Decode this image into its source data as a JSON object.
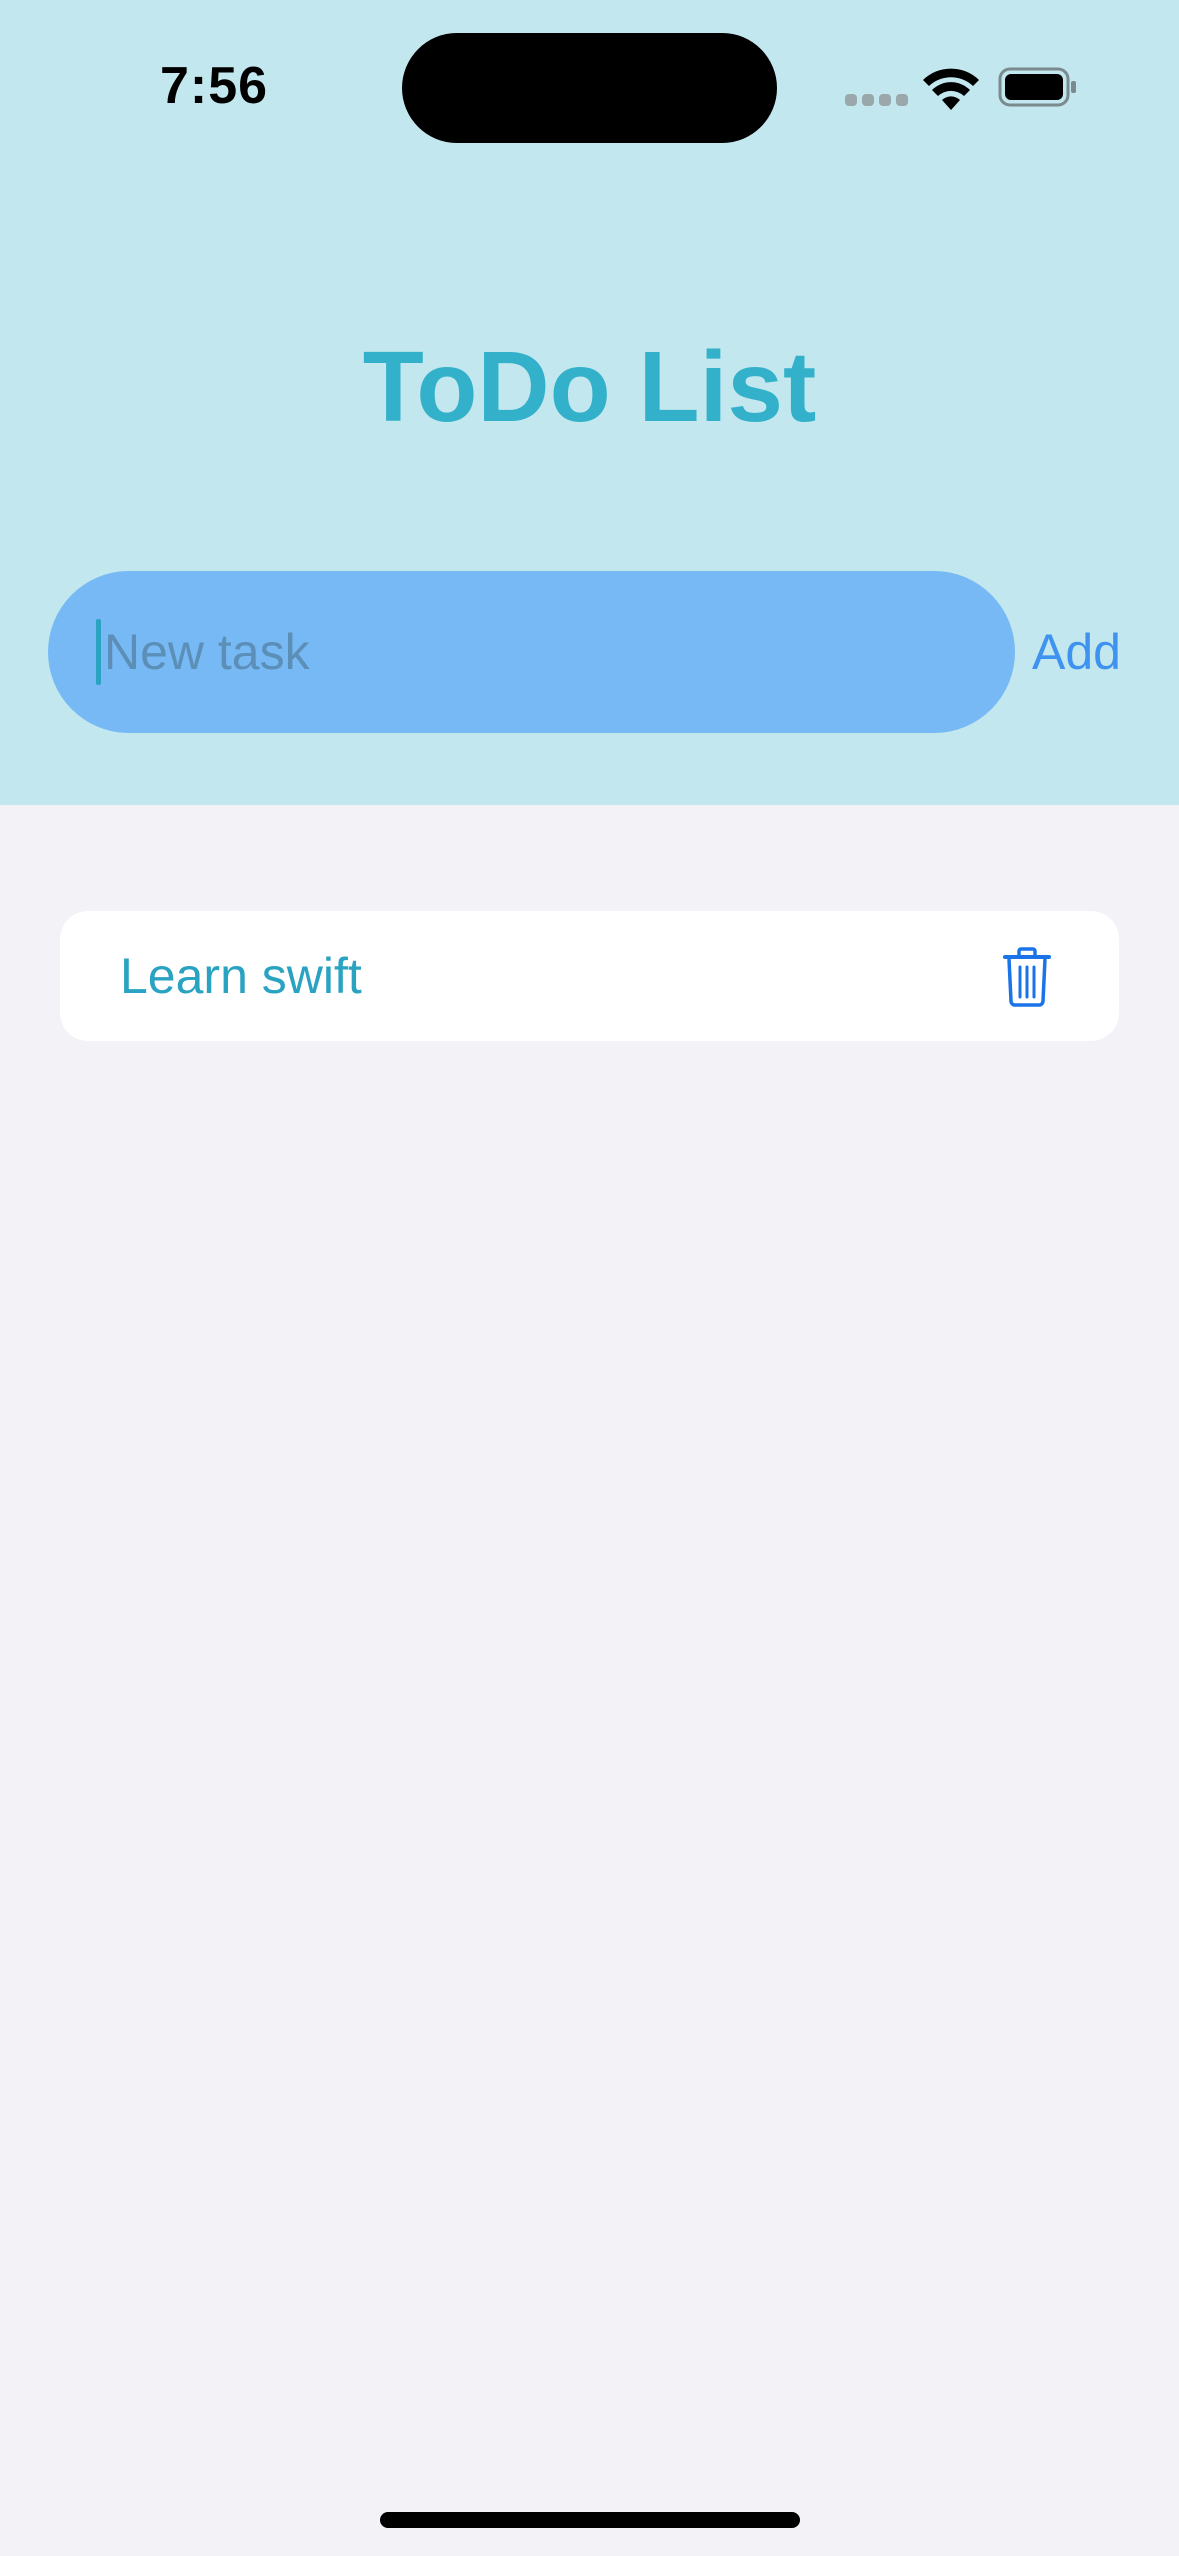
{
  "status_bar": {
    "time": "7:56"
  },
  "header": {
    "title": "ToDo List"
  },
  "new_task": {
    "value": "",
    "placeholder": "New task",
    "add_label": "Add"
  },
  "tasks": [
    {
      "label": "Learn swift"
    }
  ],
  "colors": {
    "header_bg": "#c2e7ee",
    "title": "#33b1ca",
    "input_bg": "#76b9f4",
    "accent": "#3e92f0",
    "task_text": "#2aa3c2",
    "page_bg": "#f2f2f7"
  },
  "icons": {
    "wifi": "wifi-icon",
    "battery": "battery-icon",
    "signal": "cellular-signal-icon",
    "delete": "trash-icon"
  }
}
